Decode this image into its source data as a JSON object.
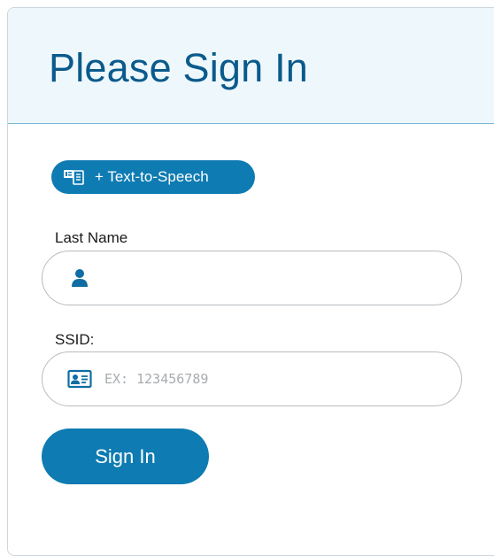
{
  "header": {
    "title": "Please Sign In"
  },
  "tts": {
    "label": "+ Text-to-Speech",
    "icon": "text-to-speech-icon"
  },
  "last_name": {
    "label": "Last Name",
    "value": "",
    "placeholder": "",
    "icon": "person-icon"
  },
  "ssid": {
    "label": "SSID:",
    "value": "",
    "placeholder": "EX: 123456789",
    "icon": "id-card-icon"
  },
  "sign_in": {
    "label": "Sign In"
  },
  "colors": {
    "accent": "#0e7bb2",
    "title": "#0b5a8c",
    "header_bg": "#eef8fc"
  }
}
